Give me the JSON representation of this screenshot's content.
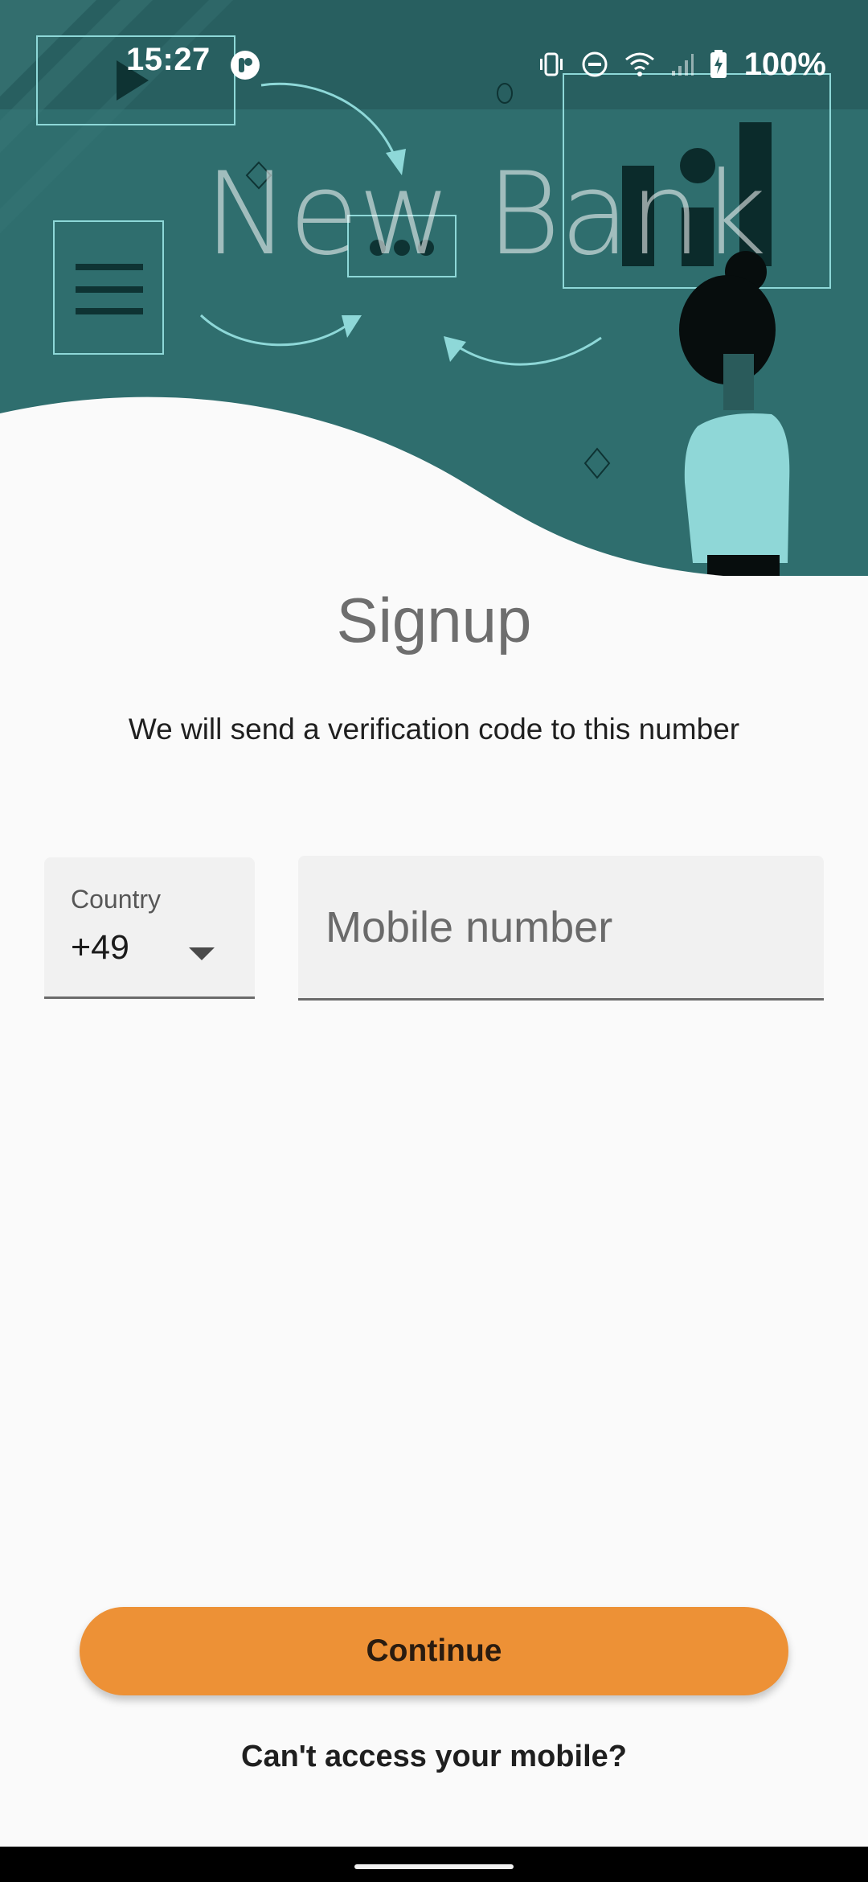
{
  "status_bar": {
    "time": "15:27",
    "battery": "100%",
    "icons": [
      "app-notification-icon",
      "vibrate-icon",
      "do-not-disturb-icon",
      "wifi-icon",
      "signal-icon",
      "battery-charging-icon"
    ]
  },
  "hero": {
    "brand": "New Bank",
    "colors": {
      "background": "#2f6e6e",
      "accent": "#8ed8d8",
      "dark": "#0a2a2a"
    }
  },
  "signup": {
    "title": "Signup",
    "subtitle": "We will send a verification code to this number"
  },
  "form": {
    "country_label": "Country",
    "country_value": "+49",
    "mobile_placeholder": "Mobile number"
  },
  "actions": {
    "continue_label": "Continue",
    "cant_access_label": "Can't access your mobile?"
  },
  "theme": {
    "primary_button": "#ed9136"
  }
}
